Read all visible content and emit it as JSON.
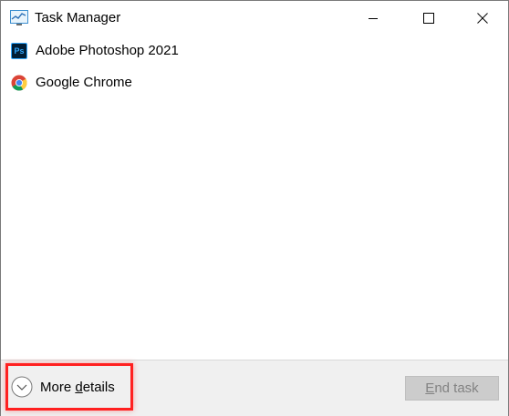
{
  "window": {
    "title": "Task Manager",
    "icons": {
      "app": "task-manager-icon",
      "minimize": "minimize-icon",
      "maximize": "maximize-icon",
      "close": "close-icon"
    }
  },
  "processes": [
    {
      "name": "Adobe Photoshop 2021",
      "icon": "photoshop-icon",
      "icon_text": "Ps"
    },
    {
      "name": "Google Chrome",
      "icon": "chrome-icon"
    }
  ],
  "footer": {
    "more_details_pre": "More ",
    "more_details_ul": "d",
    "more_details_post": "etails",
    "end_task_ul": "E",
    "end_task_post": "nd task"
  },
  "colors": {
    "highlight": "#ff2020",
    "footer_bg": "#f0f0f0",
    "disabled_button_bg": "#cccccc",
    "disabled_text": "#838383",
    "ps_bg": "#001e36",
    "ps_accent": "#31a8ff"
  }
}
